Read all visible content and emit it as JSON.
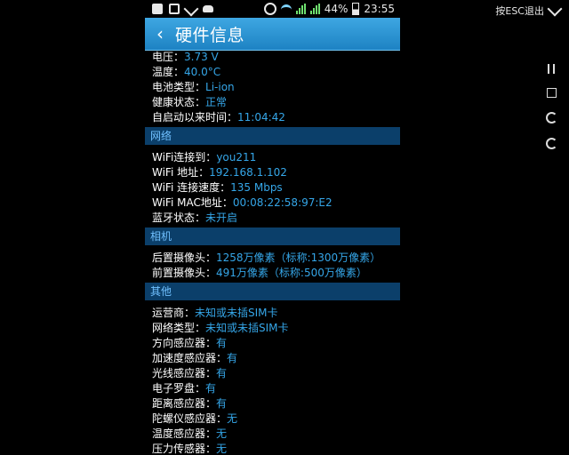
{
  "status_bar": {
    "battery_percent": "44%",
    "time": "23:55"
  },
  "header": {
    "back_icon": "‹",
    "title": "硬件信息"
  },
  "right_panel": {
    "esc_label": "按ESC退出"
  },
  "battery": {
    "items": [
      {
        "label": "电压：",
        "value": "3.73 V"
      },
      {
        "label": "温度：",
        "value": "40.0°C"
      },
      {
        "label": "电池类型：",
        "value": "Li-ion"
      },
      {
        "label": "健康状态：",
        "value": "正常"
      },
      {
        "label": "自启动以来时间：",
        "value": "11:04:42"
      }
    ]
  },
  "network": {
    "title": "网络",
    "items": [
      {
        "label": "WiFi连接到：",
        "value": "you211"
      },
      {
        "label": "WiFi 地址：",
        "value": "192.168.1.102"
      },
      {
        "label": "WiFi 连接速度：",
        "value": "135 Mbps"
      },
      {
        "label": "WiFi MAC地址：",
        "value": "00:08:22:58:97:E2"
      },
      {
        "label": "蓝牙状态：",
        "value": "未开启"
      }
    ]
  },
  "camera": {
    "title": "相机",
    "items": [
      {
        "label": "后置摄像头：",
        "value": "1258万像素（标称:1300万像素）"
      },
      {
        "label": "前置摄像头：",
        "value": "491万像素（标称:500万像素）"
      }
    ]
  },
  "other": {
    "title": "其他",
    "items": [
      {
        "label": "运营商：",
        "value": "未知或未插SIM卡"
      },
      {
        "label": "网络类型：",
        "value": "未知或未插SIM卡"
      },
      {
        "label": "方向感应器：",
        "value": "有"
      },
      {
        "label": "加速度感应器：",
        "value": "有"
      },
      {
        "label": "光线感应器：",
        "value": "有"
      },
      {
        "label": "电子罗盘：",
        "value": "有"
      },
      {
        "label": "距离感应器：",
        "value": "有"
      },
      {
        "label": "陀螺仪感应器：",
        "value": "无"
      },
      {
        "label": "温度感应器：",
        "value": "无"
      },
      {
        "label": "压力传感器：",
        "value": "无"
      }
    ]
  }
}
